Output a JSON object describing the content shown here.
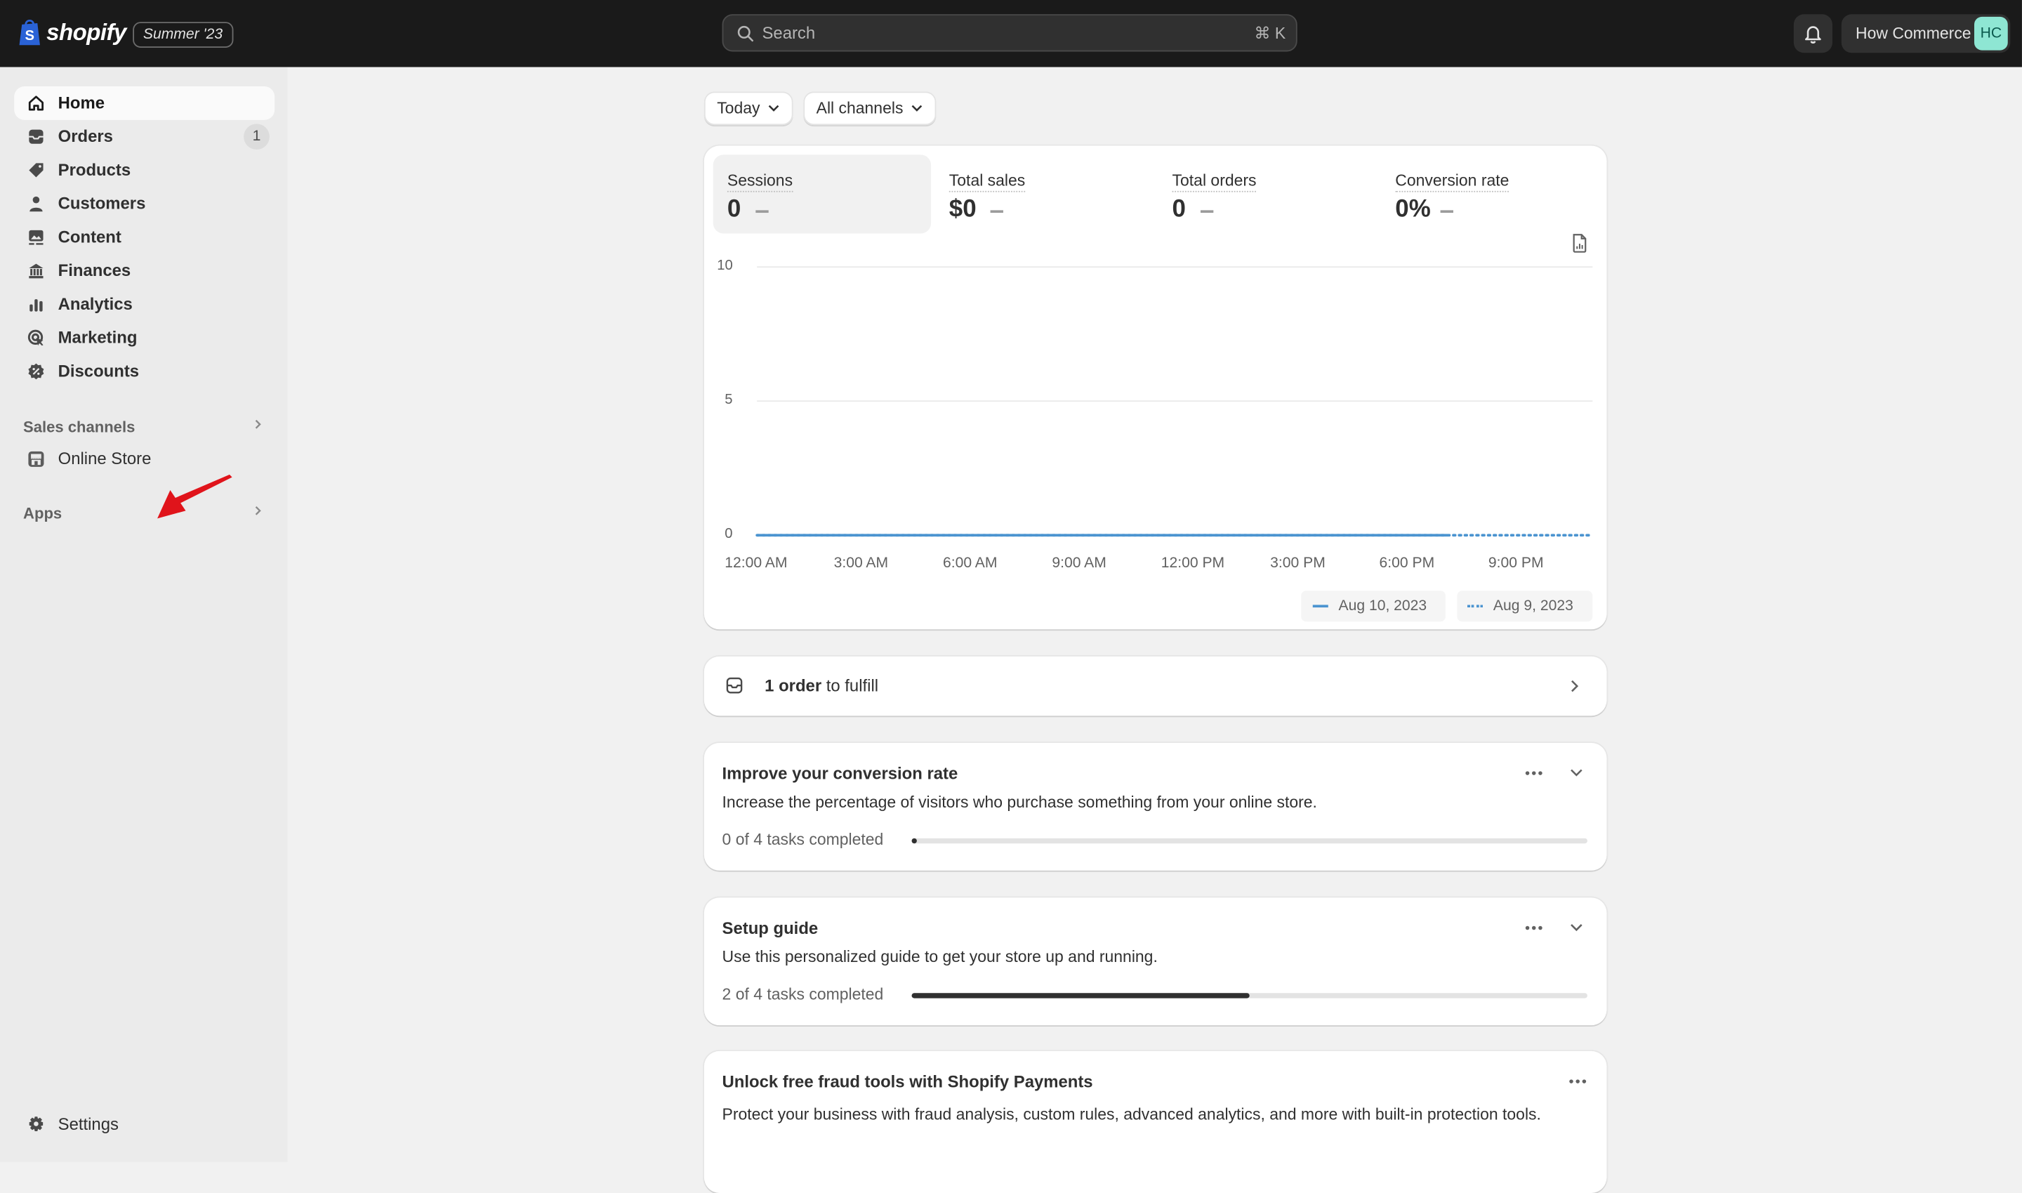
{
  "topbar": {
    "brand": "shopify",
    "season_badge": "Summer '23",
    "search_placeholder": "Search",
    "search_shortcut": "⌘ K",
    "notifications_icon": "bell-icon",
    "store_name": "How Commerce",
    "avatar_initials": "HC"
  },
  "sidebar": {
    "items": [
      {
        "label": "Home",
        "icon": "home-icon",
        "active": true
      },
      {
        "label": "Orders",
        "icon": "inbox-icon",
        "badge": "1"
      },
      {
        "label": "Products",
        "icon": "tag-icon"
      },
      {
        "label": "Customers",
        "icon": "person-icon"
      },
      {
        "label": "Content",
        "icon": "image-icon"
      },
      {
        "label": "Finances",
        "icon": "bank-icon"
      },
      {
        "label": "Analytics",
        "icon": "bar-chart-icon"
      },
      {
        "label": "Marketing",
        "icon": "target-icon"
      },
      {
        "label": "Discounts",
        "icon": "discount-icon"
      }
    ],
    "sales_channels_label": "Sales channels",
    "online_store_label": "Online Store",
    "apps_label": "Apps",
    "settings_label": "Settings"
  },
  "filters": {
    "date_range": "Today",
    "channel": "All channels"
  },
  "metrics": [
    {
      "label": "Sessions",
      "value": "0",
      "active": true
    },
    {
      "label": "Total sales",
      "value": "$0"
    },
    {
      "label": "Total orders",
      "value": "0"
    },
    {
      "label": "Conversion rate",
      "value": "0%"
    }
  ],
  "chart_data": {
    "type": "line",
    "title": "Sessions",
    "xlabel": "",
    "ylabel": "",
    "ylim": [
      0,
      10
    ],
    "y_ticks": [
      "10",
      "5",
      "0"
    ],
    "x_tick_labels": [
      "12:00 AM",
      "3:00 AM",
      "6:00 AM",
      "9:00 AM",
      "12:00 PM",
      "3:00 PM",
      "6:00 PM",
      "9:00 PM"
    ],
    "x_range_hours": [
      0,
      23
    ],
    "grid": true,
    "legend_position": "bottom-right",
    "series": [
      {
        "name": "Aug 10, 2023",
        "style": "solid",
        "color": "#4b94d0",
        "x_hours": [
          0,
          19
        ],
        "values": [
          0,
          0
        ]
      },
      {
        "name": "Aug 9, 2023",
        "style": "dotted",
        "color": "#4b94d0",
        "x_hours": [
          0,
          23
        ],
        "values": [
          0,
          0
        ]
      }
    ]
  },
  "fulfill_card": {
    "count_text": "1 order",
    "suffix_text": " to fulfill"
  },
  "conversion_card": {
    "title": "Improve your conversion rate",
    "description": "Increase the percentage of visitors who purchase something from your online store.",
    "progress_label": "0 of 4 tasks completed",
    "completed": 0,
    "total": 4
  },
  "setup_card": {
    "title": "Setup guide",
    "description": "Use this personalized guide to get your store up and running.",
    "progress_label": "2 of 4 tasks completed",
    "completed": 2,
    "total": 4
  },
  "fraud_card": {
    "title": "Unlock free fraud tools with Shopify Payments",
    "description": "Protect your business with fraud analysis, custom rules, advanced analytics, and more with built-in protection tools."
  }
}
